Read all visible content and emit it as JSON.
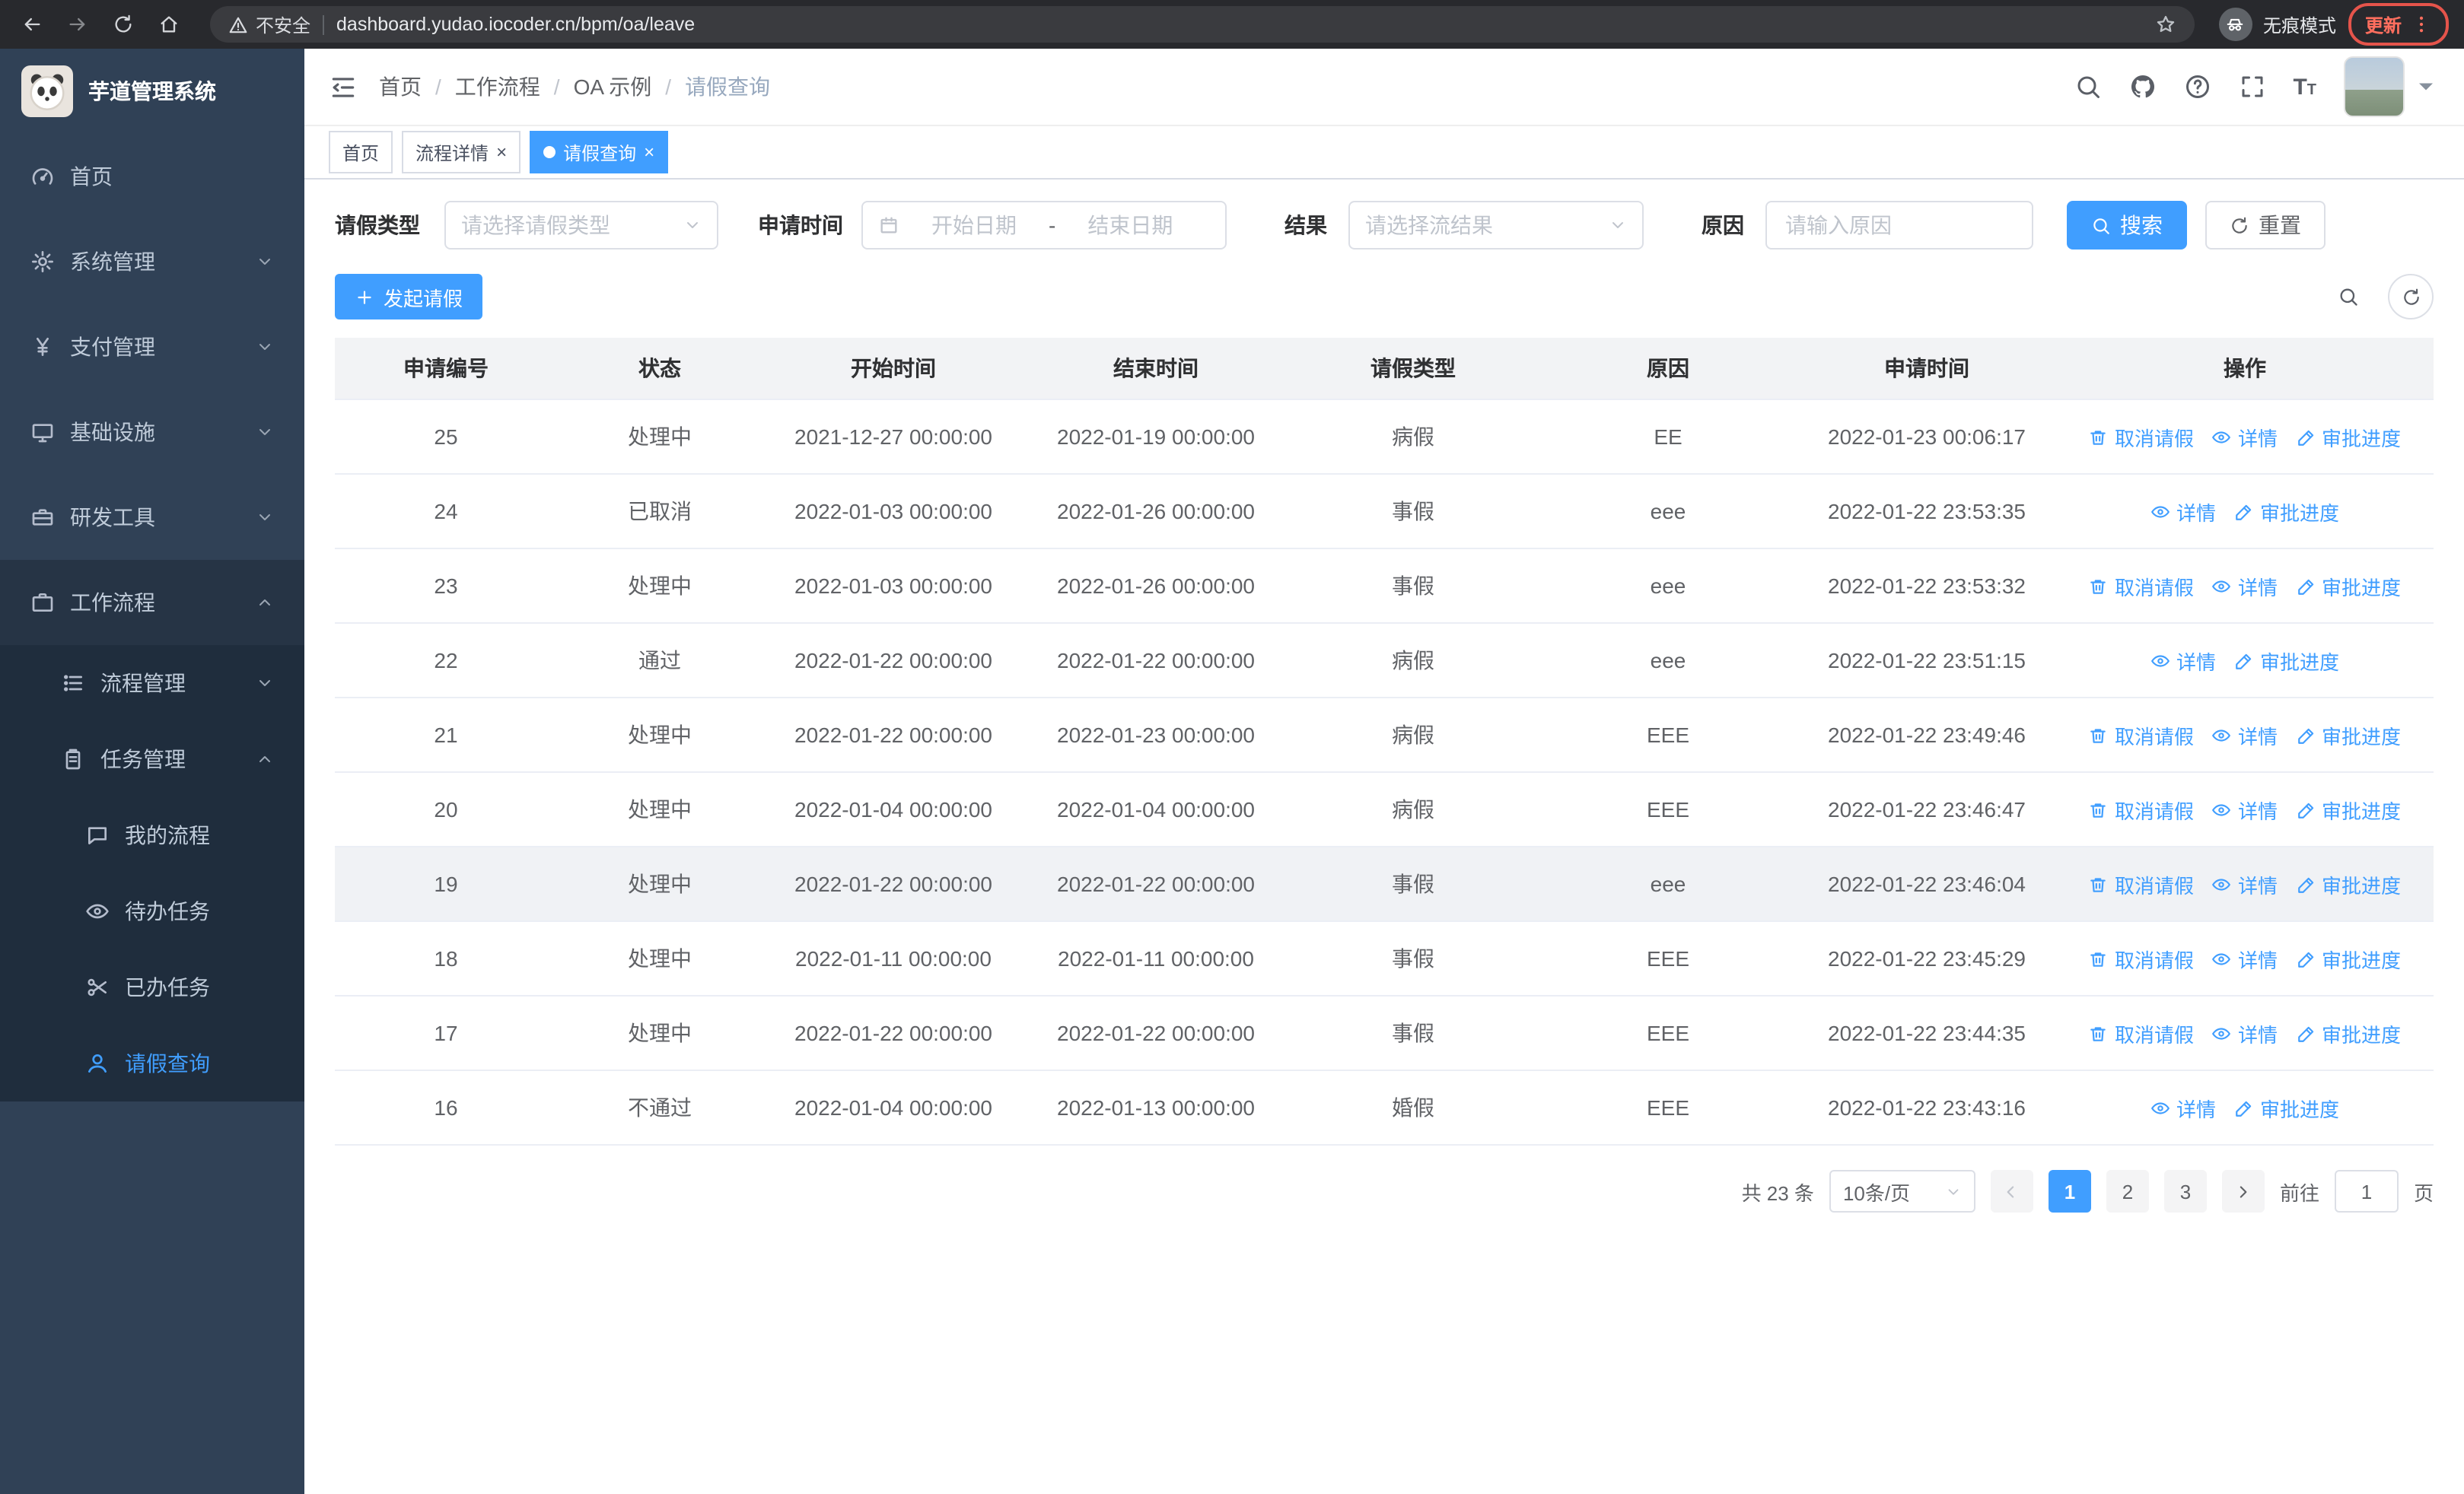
{
  "browser": {
    "security_warning": "不安全",
    "url": "dashboard.yudao.iocoder.cn/bpm/oa/leave",
    "incognito_label": "无痕模式",
    "update_label": "更新"
  },
  "sidebar": {
    "logo_title": "芋道管理系统",
    "items": [
      {
        "label": "首页",
        "icon": "gauge",
        "expandable": false,
        "expanded": false
      },
      {
        "label": "系统管理",
        "icon": "gear",
        "expandable": true,
        "expanded": false
      },
      {
        "label": "支付管理",
        "icon": "yen",
        "expandable": true,
        "expanded": false
      },
      {
        "label": "基础设施",
        "icon": "monitor",
        "expandable": true,
        "expanded": false
      },
      {
        "label": "研发工具",
        "icon": "toolbox",
        "expandable": true,
        "expanded": false
      },
      {
        "label": "工作流程",
        "icon": "briefcase",
        "expandable": true,
        "expanded": true
      }
    ],
    "submenu": [
      {
        "label": "流程管理",
        "icon": "flow",
        "expandable": true,
        "expanded": false
      },
      {
        "label": "任务管理",
        "icon": "task",
        "expandable": true,
        "expanded": true
      }
    ],
    "task_children": [
      {
        "label": "我的流程",
        "icon": "chat",
        "active": false
      },
      {
        "label": "待办任务",
        "icon": "eye",
        "active": false
      },
      {
        "label": "已办任务",
        "icon": "scissors",
        "active": false
      },
      {
        "label": "请假查询",
        "icon": "user",
        "active": true
      }
    ]
  },
  "header": {
    "breadcrumb": [
      "首页",
      "工作流程",
      "OA 示例",
      "请假查询"
    ],
    "separator": "/"
  },
  "tags": {
    "close_glyph": "×",
    "tabs": [
      {
        "label": "首页",
        "closable": false,
        "active": false
      },
      {
        "label": "流程详情",
        "closable": true,
        "active": false
      },
      {
        "label": "请假查询",
        "closable": true,
        "active": true
      }
    ]
  },
  "filters": {
    "leave_type_label": "请假类型",
    "leave_type_placeholder": "请选择请假类型",
    "apply_time_label": "申请时间",
    "start_date_placeholder": "开始日期",
    "range_separator": "-",
    "end_date_placeholder": "结束日期",
    "result_label": "结果",
    "result_placeholder": "请选择流结果",
    "reason_label": "原因",
    "reason_placeholder": "请输入原因",
    "search_label": "搜索",
    "reset_label": "重置"
  },
  "toolbar": {
    "create_label": "发起请假"
  },
  "table": {
    "columns": [
      "申请编号",
      "状态",
      "开始时间",
      "结束时间",
      "请假类型",
      "原因",
      "申请时间",
      "操作"
    ],
    "actions": {
      "cancel": "取消请假",
      "detail": "详情",
      "progress": "审批进度"
    },
    "rows": [
      {
        "id": "25",
        "status": "处理中",
        "start": "2021-12-27 00:00:00",
        "end": "2022-01-19 00:00:00",
        "type": "病假",
        "reason": "EE",
        "applied": "2022-01-23 00:06:17",
        "cancelable": true,
        "highlight": false
      },
      {
        "id": "24",
        "status": "已取消",
        "start": "2022-01-03 00:00:00",
        "end": "2022-01-26 00:00:00",
        "type": "事假",
        "reason": "eee",
        "applied": "2022-01-22 23:53:35",
        "cancelable": false,
        "highlight": false
      },
      {
        "id": "23",
        "status": "处理中",
        "start": "2022-01-03 00:00:00",
        "end": "2022-01-26 00:00:00",
        "type": "事假",
        "reason": "eee",
        "applied": "2022-01-22 23:53:32",
        "cancelable": true,
        "highlight": false
      },
      {
        "id": "22",
        "status": "通过",
        "start": "2022-01-22 00:00:00",
        "end": "2022-01-22 00:00:00",
        "type": "病假",
        "reason": "eee",
        "applied": "2022-01-22 23:51:15",
        "cancelable": false,
        "highlight": false
      },
      {
        "id": "21",
        "status": "处理中",
        "start": "2022-01-22 00:00:00",
        "end": "2022-01-23 00:00:00",
        "type": "病假",
        "reason": "EEE",
        "applied": "2022-01-22 23:49:46",
        "cancelable": true,
        "highlight": false
      },
      {
        "id": "20",
        "status": "处理中",
        "start": "2022-01-04 00:00:00",
        "end": "2022-01-04 00:00:00",
        "type": "病假",
        "reason": "EEE",
        "applied": "2022-01-22 23:46:47",
        "cancelable": true,
        "highlight": false
      },
      {
        "id": "19",
        "status": "处理中",
        "start": "2022-01-22 00:00:00",
        "end": "2022-01-22 00:00:00",
        "type": "事假",
        "reason": "eee",
        "applied": "2022-01-22 23:46:04",
        "cancelable": true,
        "highlight": true
      },
      {
        "id": "18",
        "status": "处理中",
        "start": "2022-01-11 00:00:00",
        "end": "2022-01-11 00:00:00",
        "type": "事假",
        "reason": "EEE",
        "applied": "2022-01-22 23:45:29",
        "cancelable": true,
        "highlight": false
      },
      {
        "id": "17",
        "status": "处理中",
        "start": "2022-01-22 00:00:00",
        "end": "2022-01-22 00:00:00",
        "type": "事假",
        "reason": "EEE",
        "applied": "2022-01-22 23:44:35",
        "cancelable": true,
        "highlight": false
      },
      {
        "id": "16",
        "status": "不通过",
        "start": "2022-01-04 00:00:00",
        "end": "2022-01-13 00:00:00",
        "type": "婚假",
        "reason": "EEE",
        "applied": "2022-01-22 23:43:16",
        "cancelable": false,
        "highlight": false
      }
    ]
  },
  "pagination": {
    "total": "共 23 条",
    "page_size": "10条/页",
    "pages": [
      "1",
      "2",
      "3"
    ],
    "active_page": "1",
    "goto_label": "前往",
    "goto_value": "1",
    "page_label": "页"
  },
  "colors": {
    "primary": "#409eff",
    "sidebar_bg": "#304156",
    "submenu_bg": "#1f2d3d",
    "update_red": "#ff6e5e"
  }
}
